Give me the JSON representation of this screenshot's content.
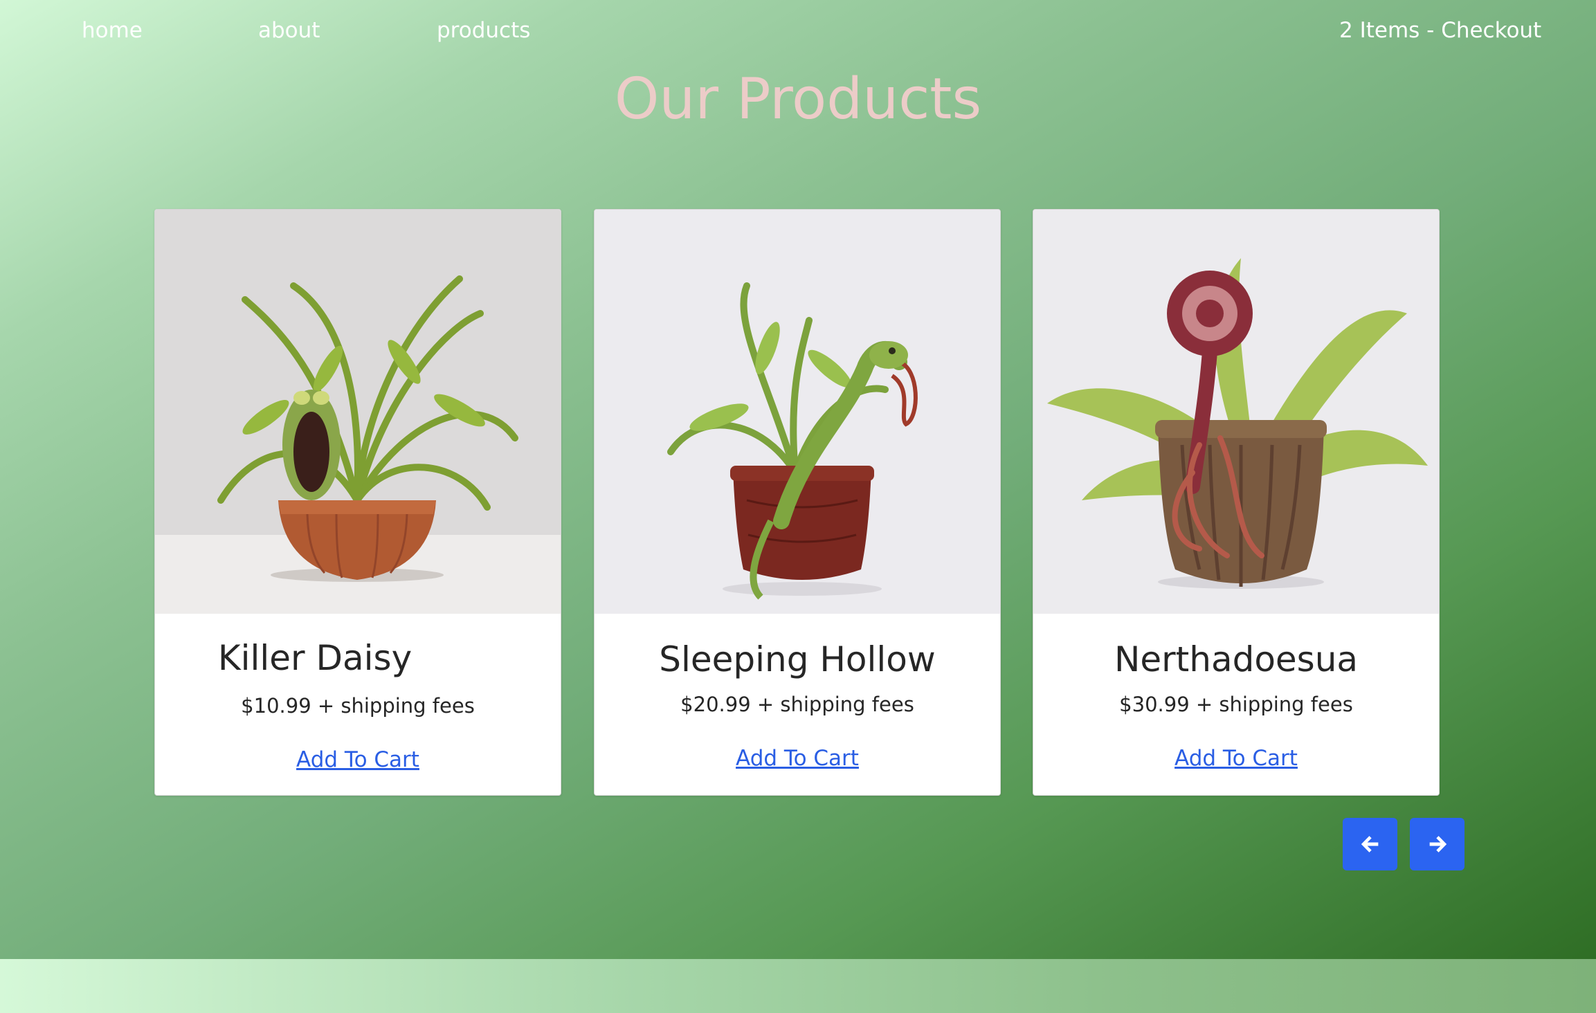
{
  "nav": {
    "home": "home",
    "about": "about",
    "products": "products",
    "checkout": "2 Items - Checkout"
  },
  "page": {
    "title": "Our Products"
  },
  "products": [
    {
      "name": "Killer Daisy",
      "price": "$10.99 + shipping fees",
      "action": "Add To Cart",
      "image_icon": "carnivorous-plant-icon"
    },
    {
      "name": "Sleeping Hollow",
      "price": "$20.99 + shipping fees",
      "action": "Add To Cart",
      "image_icon": "carnivorous-plant-icon"
    },
    {
      "name": "Nerthadoesua",
      "price": "$30.99 + shipping fees",
      "action": "Add To Cart",
      "image_icon": "carnivorous-plant-icon"
    }
  ],
  "carousel": {
    "prev_icon": "arrow-left-icon",
    "next_icon": "arrow-right-icon"
  },
  "colors": {
    "title": "#ecccc8",
    "nav_text": "#ffffff",
    "link": "#2a5ee4",
    "button": "#2b64f1",
    "background_light": "#d2f7d6",
    "background_dark": "#2f6e25"
  }
}
